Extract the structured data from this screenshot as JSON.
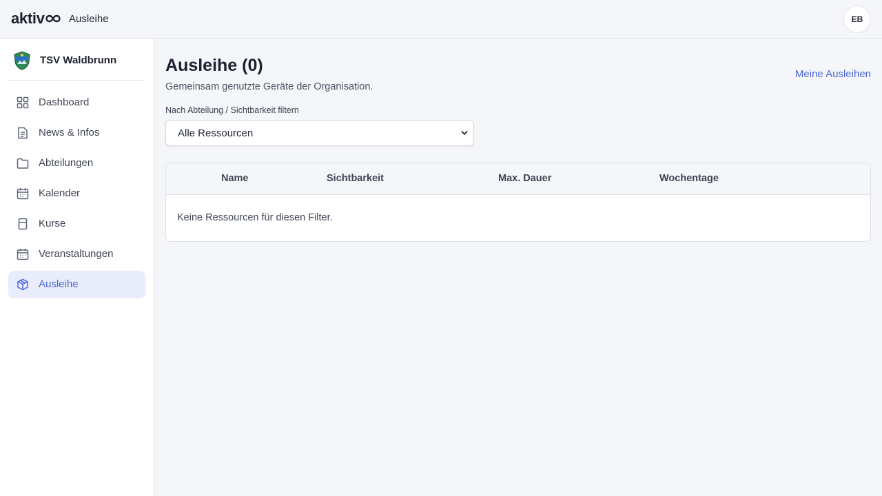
{
  "header": {
    "logo_text": "aktiv",
    "app_title": "Ausleihe",
    "avatar_initials": "EB"
  },
  "sidebar": {
    "org_name": "TSV Waldbrunn",
    "items": [
      {
        "label": "Dashboard",
        "icon": "grid-icon",
        "active": false
      },
      {
        "label": "News & Infos",
        "icon": "document-icon",
        "active": false
      },
      {
        "label": "Abteilungen",
        "icon": "folder-icon",
        "active": false
      },
      {
        "label": "Kalender",
        "icon": "calendar-icon",
        "active": false
      },
      {
        "label": "Kurse",
        "icon": "book-icon",
        "active": false
      },
      {
        "label": "Veranstaltungen",
        "icon": "calendar-icon",
        "active": false
      },
      {
        "label": "Ausleihe",
        "icon": "box-icon",
        "active": true
      }
    ]
  },
  "main": {
    "title": "Ausleihe (0)",
    "subtitle": "Gemeinsam genutzte Geräte der Organisation.",
    "my_loans_link": "Meine Ausleihen",
    "filter": {
      "label": "Nach Abteilung / Sichtbarkeit filtern",
      "selected": "Alle Ressourcen"
    },
    "table": {
      "columns": [
        "Name",
        "Sichtbarkeit",
        "Max. Dauer",
        "Wochentage"
      ],
      "rows": [],
      "empty_message": "Keine Ressourcen für diesen Filter."
    }
  },
  "colors": {
    "accent": "#4a64d6",
    "active_bg": "#e8ecfb",
    "page_bg": "#f5f6f9",
    "text": "#1f2430"
  }
}
